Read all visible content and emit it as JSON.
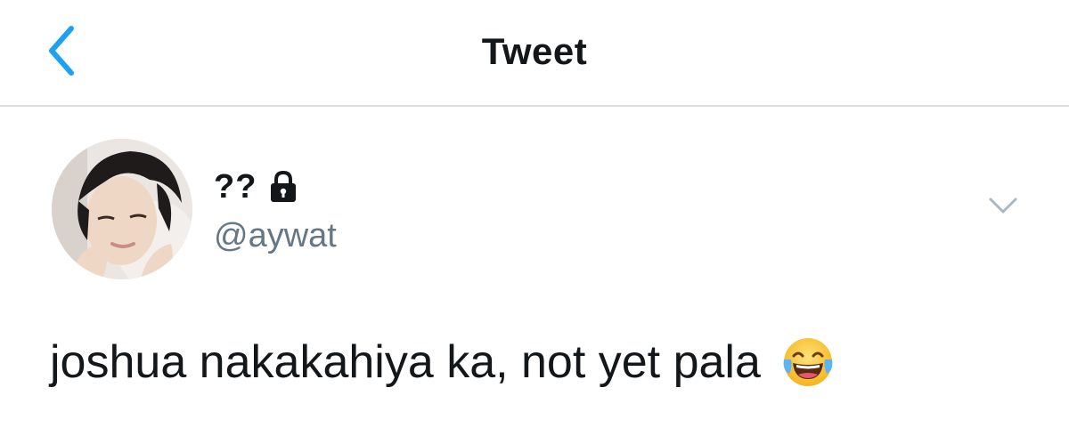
{
  "header": {
    "title": "Tweet",
    "back_icon": "chevron-left-icon",
    "accent_color": "#1da1f2"
  },
  "tweet": {
    "author": {
      "display_name": "??",
      "protected_icon": "lock-icon",
      "handle": "@aywat"
    },
    "menu_icon": "chevron-down-icon",
    "text": "joshua nakakahiya ka, not yet pala",
    "emoji": "face-with-tears-of-joy-icon"
  },
  "colors": {
    "text_primary": "#14171a",
    "text_secondary": "#657786",
    "divider": "#d9dde2"
  }
}
